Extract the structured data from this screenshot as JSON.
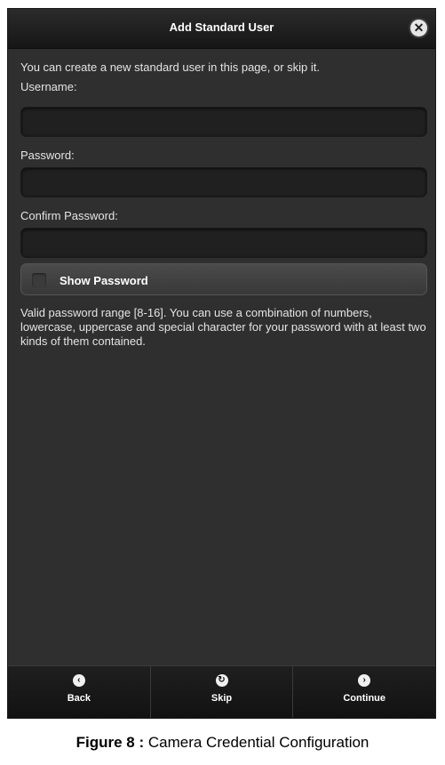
{
  "dialog": {
    "title": "Add Standard User",
    "close_icon": "close-icon",
    "intro_text": "You can create a new standard user in this page, or skip it.",
    "username_label": "Username:",
    "username_value": "",
    "password_label": "Password:",
    "password_value": "",
    "confirm_password_label": "Confirm Password:",
    "confirm_password_value": "",
    "show_password_label": "Show Password",
    "show_password_checked": false,
    "help_text": "Valid password range [8-16]. You can use a combination of numbers, lowercase, uppercase and special character for your password with at least two kinds of them contained."
  },
  "footer": {
    "back_label": "Back",
    "back_icon": "chevron-left-icon",
    "skip_label": "Skip",
    "skip_icon": "refresh-icon",
    "continue_label": "Continue",
    "continue_icon": "chevron-right-icon"
  },
  "caption": {
    "prefix": "Figure 8 :",
    "text": "Camera Credential Configuration"
  }
}
